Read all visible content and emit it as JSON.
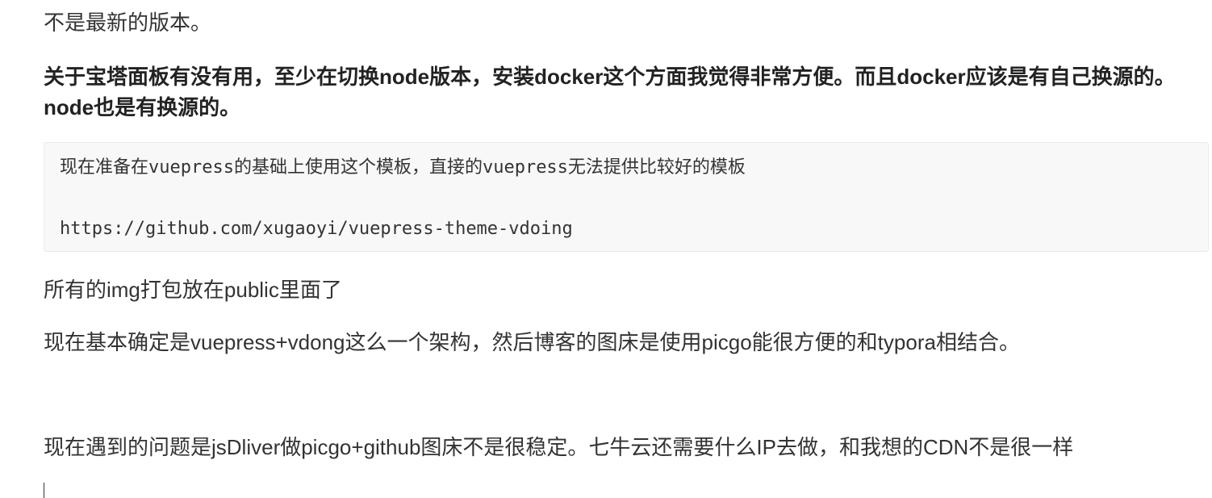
{
  "editor": {
    "paragraphs": {
      "p1": "不是最新的版本。",
      "p2_bold": "关于宝塔面板有没有用，至少在切换node版本，安装docker这个方面我觉得非常方便。而且docker应该是有自己换源的。node也是有换源的。",
      "code_block": {
        "line1": "现在准备在vuepress的基础上使用这个模板，直接的vuepress无法提供比较好的模板",
        "line2": "https://github.com/xugaoyi/vuepress-theme-vdoing"
      },
      "p3": "所有的img打包放在public里面了",
      "p4": "现在基本确定是vuepress+vdong这么一个架构，然后博客的图床是使用picgo能很方便的和typora相结合。",
      "p5": "现在遇到的问题是jsDliver做picgo+github图床不是很稳定。七牛云还需要什么IP去做，和我想的CDN不是很一样"
    }
  }
}
